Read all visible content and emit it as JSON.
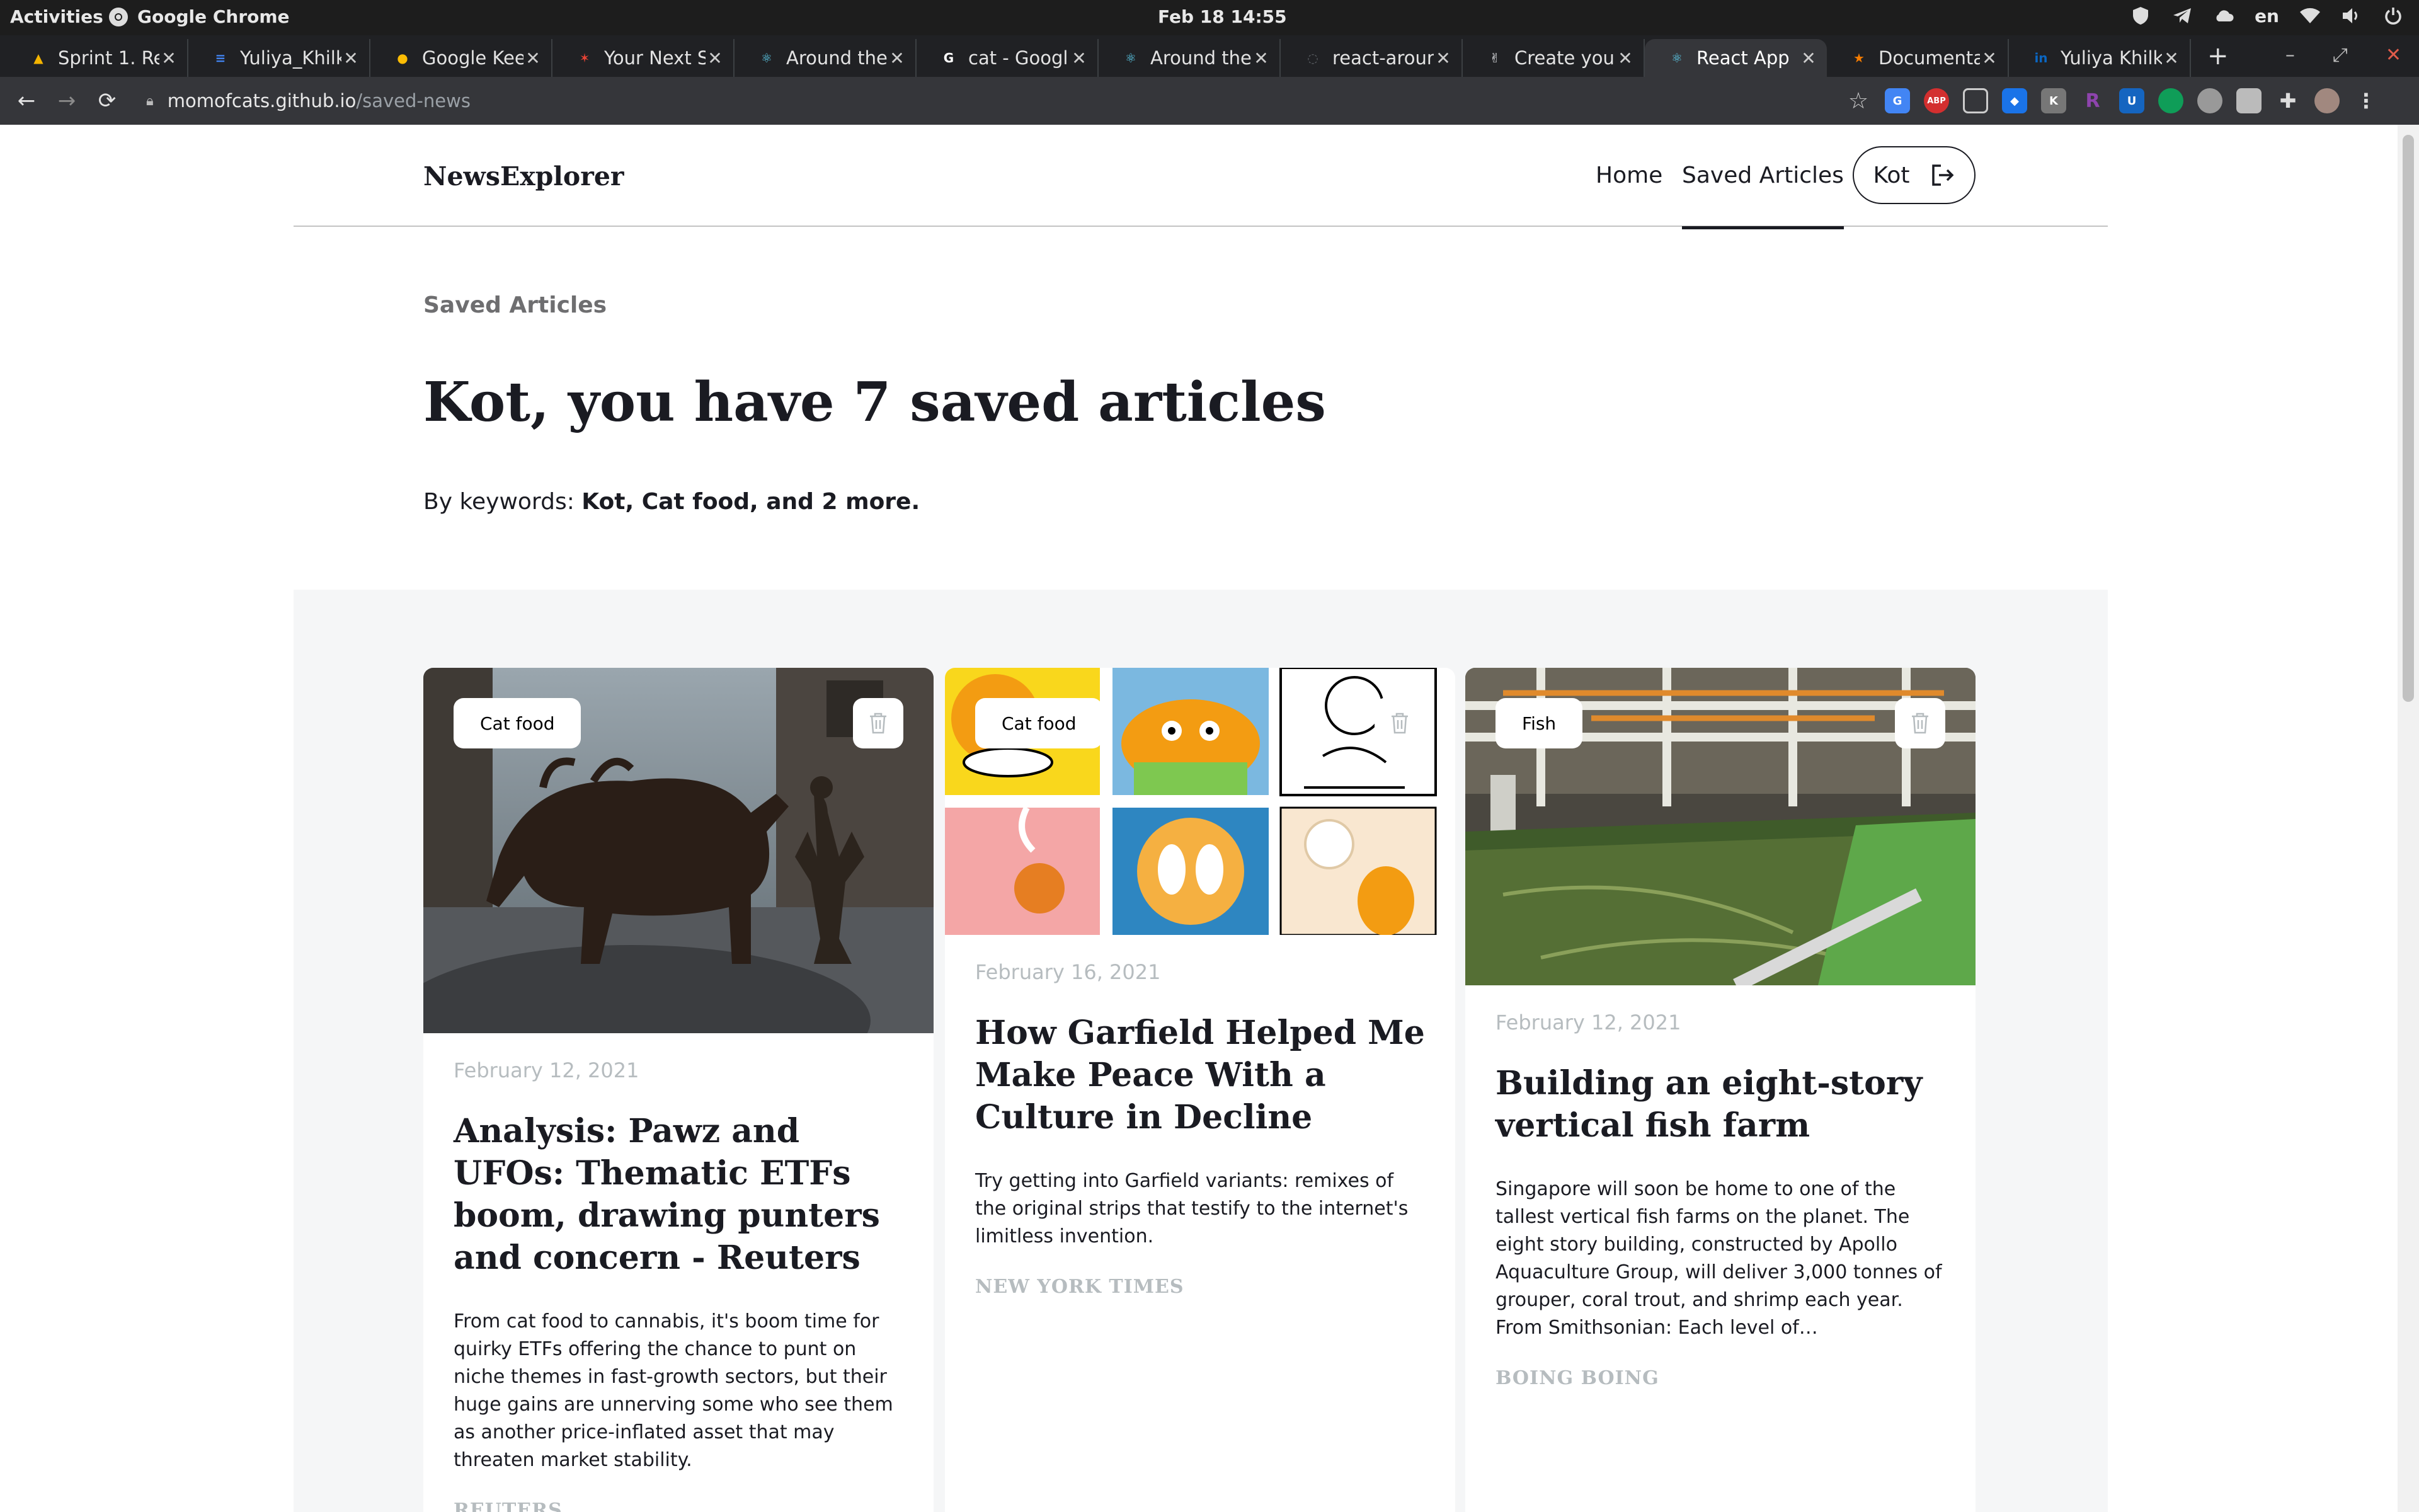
{
  "os": {
    "activities": "Activities",
    "app_name": "Google Chrome",
    "clock": "Feb 18  14:55",
    "lang": "en"
  },
  "tabs": [
    {
      "title": "Sprint 1. Re",
      "color": "#f4b400",
      "glyph": "▲"
    },
    {
      "title": "Yuliya_Khilk",
      "color": "#4285f4",
      "glyph": "≡"
    },
    {
      "title": "Google Kee",
      "color": "#fbbc04",
      "glyph": "●"
    },
    {
      "title": "Your Next S",
      "color": "#ea4335",
      "glyph": "✶"
    },
    {
      "title": "Around the",
      "color": "#61dafb",
      "glyph": "⚛"
    },
    {
      "title": "cat - Googl",
      "color": "#ffffff",
      "glyph": "G"
    },
    {
      "title": "Around the",
      "color": "#61dafb",
      "glyph": "⚛"
    },
    {
      "title": "react-arour",
      "color": "#5f6368",
      "glyph": "◌"
    },
    {
      "title": "Create you",
      "color": "#e8eaed",
      "glyph": "✌"
    },
    {
      "title": "React App",
      "color": "#61dafb",
      "glyph": "⚛"
    },
    {
      "title": "Documenta",
      "color": "#f57c00",
      "glyph": "★"
    },
    {
      "title": "Yuliya Khilk",
      "color": "#0a66c2",
      "glyph": "in"
    }
  ],
  "browser": {
    "url_domain": "momofcats.github.io",
    "url_path": "/saved-news"
  },
  "site": {
    "logo": "NewsExplorer",
    "nav_home": "Home",
    "nav_saved": "Saved Articles",
    "user_name": "Kot"
  },
  "summary": {
    "section_label": "Saved Articles",
    "headline": "Kot, you have 7 saved articles",
    "keywords_prefix": "By keywords: ",
    "keywords": "Kot, Cat food, and 2 more."
  },
  "articles": [
    {
      "tag": "Cat food",
      "date": "February 12, 2021",
      "title": "Analysis: Pawz and UFOs: Thematic ETFs boom, drawing punters and concern - Reuters",
      "text": "From cat food to cannabis, it's boom time for quirky ETFs offering the chance to punt on niche themes in fast-growth sectors, but their huge gains are unnerving some who see them as another price-inflated asset that may threaten market stability.",
      "source": "REUTERS"
    },
    {
      "tag": "Cat food",
      "date": "February 16, 2021",
      "title": "How Garfield Helped Me Make Peace With a Culture in Decline",
      "text": "Try getting into Garfield variants: remixes of the original strips that testify to the internet's limitless invention.",
      "source": "NEW YORK TIMES"
    },
    {
      "tag": "Fish",
      "date": "February 12, 2021",
      "title": "Building an eight-story vertical fish farm",
      "text": "Singapore will soon be home to one of the tallest vertical fish farms on the planet. The eight story building, constructed by Apollo Aquaculture Group, will deliver 3,000 tonnes of grouper, coral trout, and shrimp each year. From Smithsonian: Each level of…",
      "source": "BOING BOING"
    }
  ]
}
